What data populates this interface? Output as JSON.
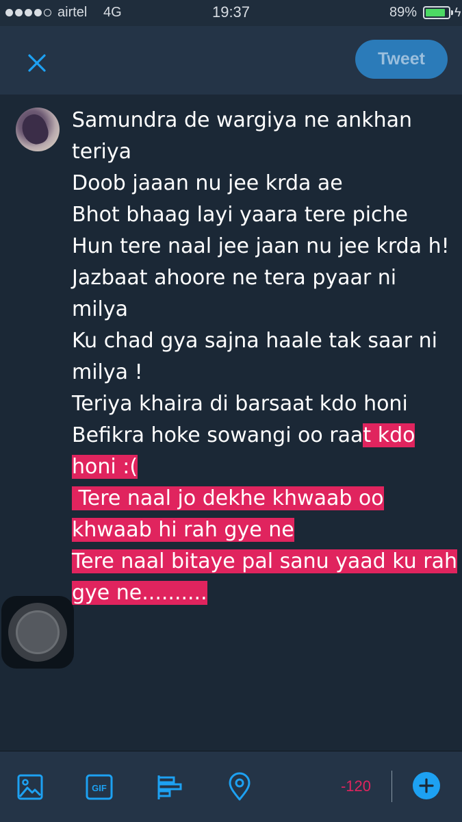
{
  "status_bar": {
    "carrier": "airtel",
    "network": "4G",
    "time": "19:37",
    "battery_percent": "89%",
    "battery_level": 0.89,
    "signal_bars": 4
  },
  "header": {
    "close_icon": "close-icon",
    "tweet_label": "Tweet"
  },
  "compose": {
    "lines": [
      "Samundra de wargiya ne ankhan",
      "teriya",
      "Doob jaaan nu jee krda ae",
      "Bhot bhaag layi yaara tere piche",
      "Hun tere naal jee jaan nu jee krda h!",
      "Jazbaat ahoore ne tera pyaar ni",
      "milya",
      "Ku chad gya sajna haale tak saar ni",
      "milya !",
      "Teriya khaira di barsaat kdo honi",
      "Befikra hoke sowangi oo raa",
      "t kdo",
      "honi :(",
      " Tere naal jo dekhe khwaab oo",
      "khwaab hi rah gye ne",
      "Tere naal bitaye pal sanu yaad ku rah",
      "gye ne.........."
    ]
  },
  "toolbar": {
    "icons": [
      "image-icon",
      "gif-icon",
      "poll-icon",
      "location-icon",
      "add-icon"
    ],
    "gif_label": "GIF",
    "char_count": "-120"
  },
  "colors": {
    "background": "#1b2836",
    "header": "#243447",
    "accent": "#1da1f2",
    "selection": "#e0245e"
  }
}
